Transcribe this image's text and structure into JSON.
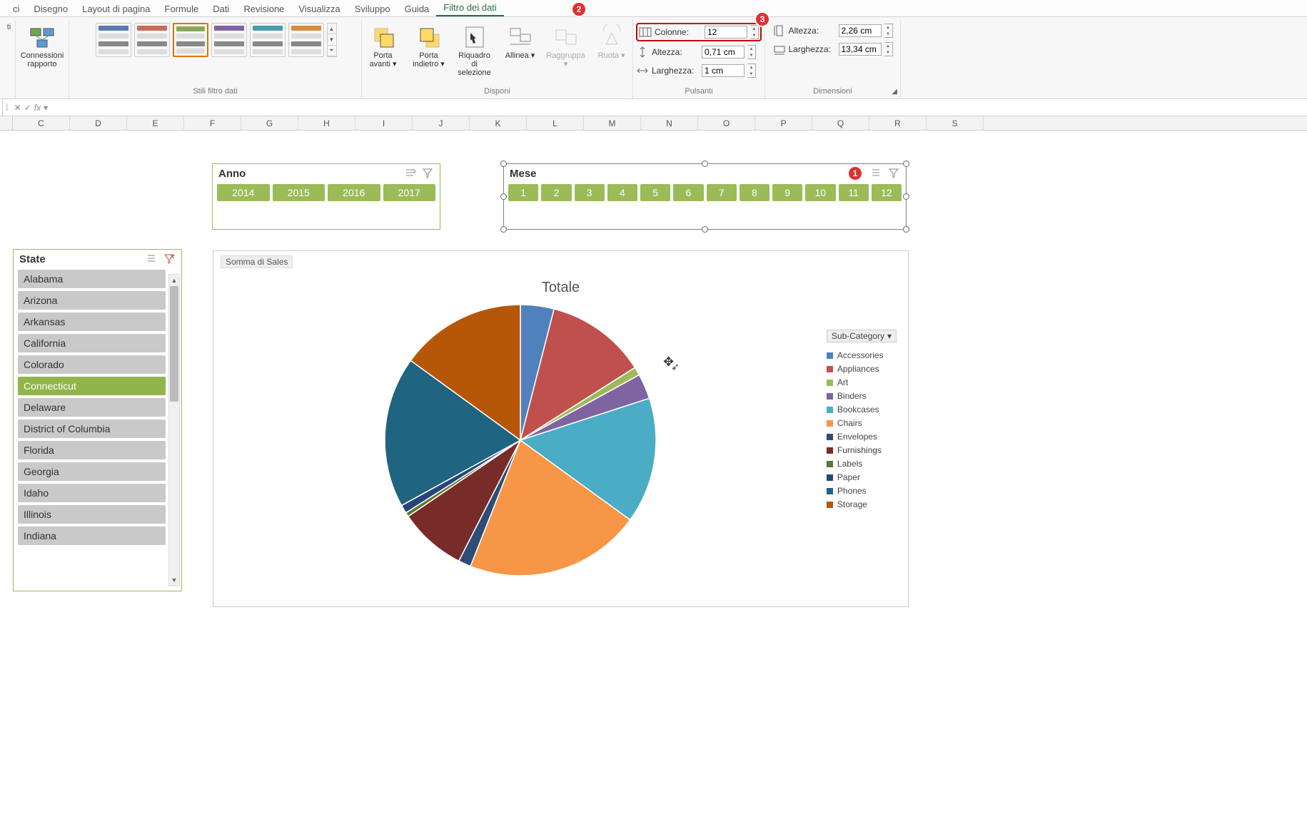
{
  "tabs": {
    "disegno": "Disegno",
    "layout": "Layout di pagina",
    "formule": "Formule",
    "dati": "Dati",
    "revisione": "Revisione",
    "visualizza": "Visualizza",
    "sviluppo": "Sviluppo",
    "guida": "Guida",
    "filtro": "Filtro dei dati"
  },
  "ribbon": {
    "connessioni": "Connessioni rapporto",
    "stili": "Stili filtro dati",
    "porta_avanti": "Porta avanti",
    "porta_indietro": "Porta indietro",
    "riquadro": "Riquadro di selezione",
    "allinea": "Allinea",
    "raggruppa": "Raggruppa",
    "ruota": "Ruota",
    "disponi": "Disponi",
    "colonne_label": "Colonne:",
    "colonne_value": "12",
    "altezza_btn_label": "Altezza:",
    "altezza_btn_value": "0,71 cm",
    "larghezza_btn_label": "Larghezza:",
    "larghezza_btn_value": "1 cm",
    "pulsanti": "Pulsanti",
    "altezza_dim_label": "Altezza:",
    "altezza_dim_value": "2,26 cm",
    "larghezza_dim_label": "Larghezza:",
    "larghezza_dim_value": "13,34 cm",
    "dimensioni": "Dimensioni"
  },
  "style_colors": [
    "#5a7bb0",
    "#c96b5a",
    "#8aa758",
    "#8264a3",
    "#4a9bb0",
    "#d68b3e"
  ],
  "badges": {
    "b1": "1",
    "b2": "2",
    "b3": "3"
  },
  "formula": {
    "value": ""
  },
  "columns": [
    "C",
    "D",
    "E",
    "F",
    "G",
    "H",
    "I",
    "J",
    "K",
    "L",
    "M",
    "N",
    "O",
    "P",
    "Q",
    "R",
    "S"
  ],
  "anno_slicer": {
    "title": "Anno",
    "items": [
      "2014",
      "2015",
      "2016",
      "2017"
    ]
  },
  "mese_slicer": {
    "title": "Mese",
    "items": [
      "1",
      "2",
      "3",
      "4",
      "5",
      "6",
      "7",
      "8",
      "9",
      "10",
      "11",
      "12"
    ]
  },
  "state_slicer": {
    "title": "State",
    "items": [
      "Alabama",
      "Arizona",
      "Arkansas",
      "California",
      "Colorado",
      "Connecticut",
      "Delaware",
      "District of Columbia",
      "Florida",
      "Georgia",
      "Idaho",
      "Illinois",
      "Indiana"
    ],
    "selected_index": 5
  },
  "chart": {
    "field_label": "Somma di Sales",
    "title": "Totale",
    "legend_title": "Sub-Category"
  },
  "chart_data": {
    "type": "pie",
    "title": "Totale",
    "series_name": "Sub-Category",
    "categories": [
      "Accessories",
      "Appliances",
      "Art",
      "Binders",
      "Bookcases",
      "Chairs",
      "Envelopes",
      "Furnishings",
      "Labels",
      "Paper",
      "Phones",
      "Storage"
    ],
    "values": [
      4,
      12,
      1,
      3,
      15,
      21,
      1.5,
      8,
      0.5,
      1,
      18,
      15
    ],
    "colors": [
      "#4f81bd",
      "#c0504d",
      "#9bbb59",
      "#8064a2",
      "#4bacc6",
      "#f79646",
      "#2c4d75",
      "#772c2a",
      "#5f7530",
      "#264478",
      "#1f6481",
      "#b65708"
    ]
  }
}
